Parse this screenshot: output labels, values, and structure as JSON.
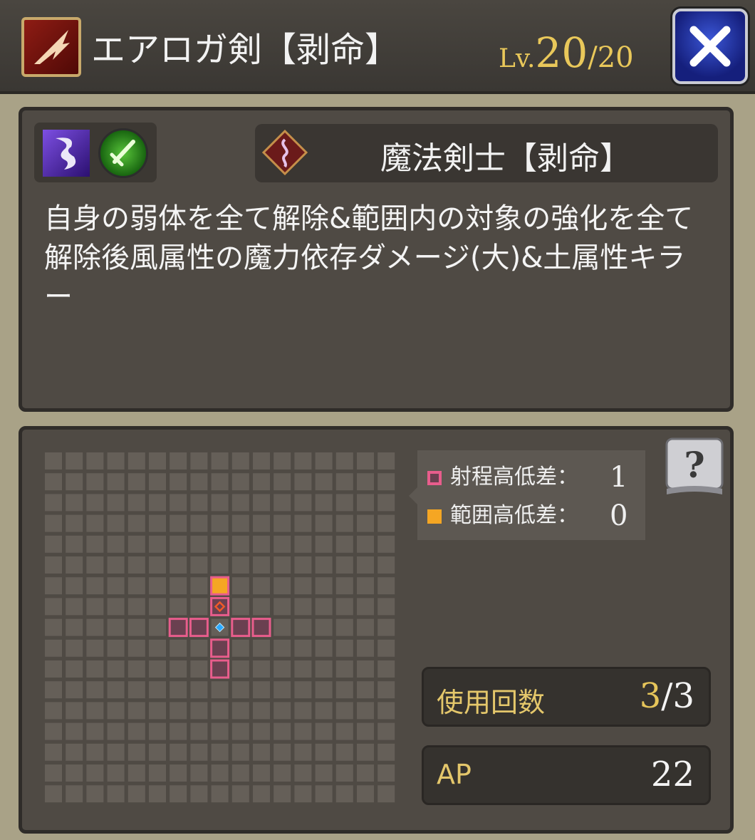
{
  "header": {
    "skill_name": "エアロガ剣【剥命】",
    "level_label": "Lv.",
    "level_current": "20",
    "level_max": "/20",
    "close_icon": "close-x-icon"
  },
  "skill": {
    "element_icon": "wind-element-icon",
    "weapon_icon": "sword-weapon-icon",
    "class_emblem": "mage-class-emblem",
    "class_name": "魔法剣士【剥命】",
    "description": "自身の弱体を全て解除&範囲内の対象の強化を全て解除後風属性の魔力依存ダメージ(大)&土属性キラー"
  },
  "range": {
    "legend": [
      {
        "label": "射程高低差：",
        "value": "1",
        "color": "#e85d8c"
      },
      {
        "label": "範囲高低差：",
        "value": "0",
        "color": "#f5a623"
      }
    ],
    "grid": {
      "cols": 17,
      "rows": 17,
      "origin": [
        8,
        8
      ],
      "range_cells": [
        [
          6,
          8
        ],
        [
          7,
          8
        ],
        [
          9,
          8
        ],
        [
          10,
          8
        ],
        [
          8,
          7
        ],
        [
          8,
          9
        ],
        [
          8,
          10
        ]
      ],
      "area_cells": [
        [
          8,
          6
        ]
      ],
      "target_cell": [
        8,
        7
      ],
      "colors": {
        "cell": "#655f58",
        "range": "#e85d8c",
        "area": "#f5a623",
        "origin": "#29a8ff"
      }
    },
    "help_icon": "question-book-icon"
  },
  "stats": {
    "uses_label": "使用回数",
    "uses_current": "3",
    "uses_max": "/3",
    "ap_label": "AP",
    "ap_value": "22"
  }
}
